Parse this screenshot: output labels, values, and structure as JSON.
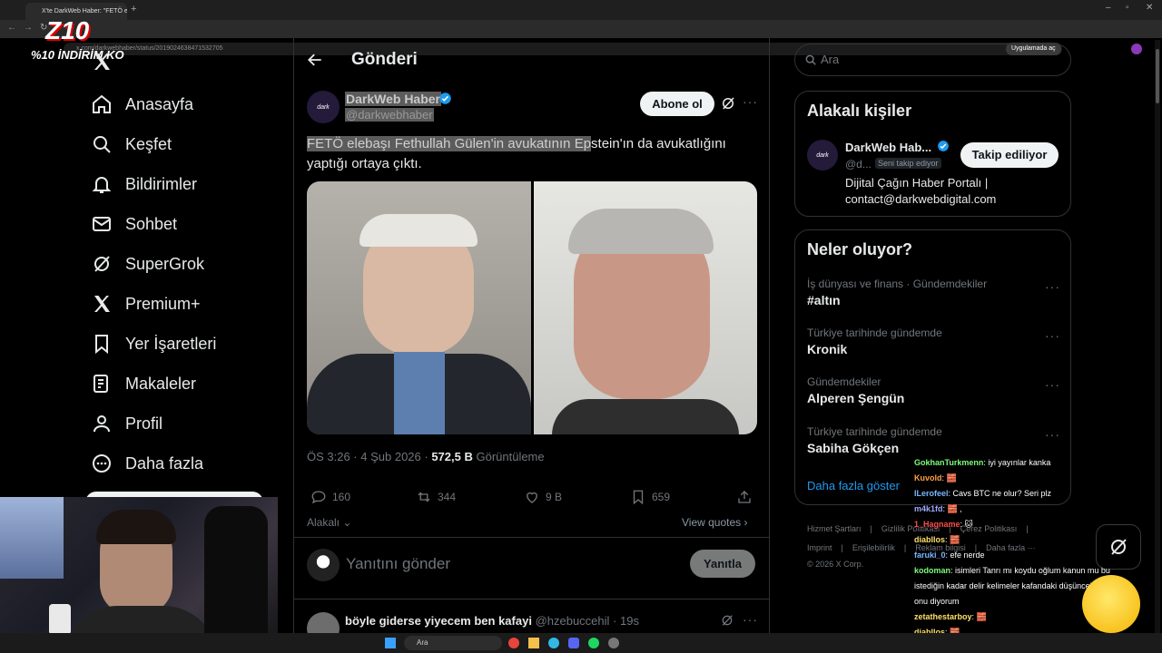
{
  "browser": {
    "tab_title": "X'te DarkWeb Haber: \"FETÖ ele...",
    "url": "x.com/darkwebhaber/status/2019024638471532705",
    "open_in_app": "Uygulamada aç"
  },
  "overlay": {
    "brand_logo": "Z10",
    "discount": "%10 İNDİRİM KO"
  },
  "nav": {
    "items": [
      {
        "label": "Anasayfa",
        "icon": "home-icon"
      },
      {
        "label": "Keşfet",
        "icon": "search-icon"
      },
      {
        "label": "Bildirimler",
        "icon": "bell-icon"
      },
      {
        "label": "Sohbet",
        "icon": "mail-icon"
      },
      {
        "label": "SuperGrok",
        "icon": "grok-icon"
      },
      {
        "label": "Premium+",
        "icon": "x-logo-icon"
      },
      {
        "label": "Yer İşaretleri",
        "icon": "bookmark-icon"
      },
      {
        "label": "Makaleler",
        "icon": "article-icon"
      },
      {
        "label": "Profil",
        "icon": "person-icon"
      },
      {
        "label": "Daha fazla",
        "icon": "more-circle-icon"
      }
    ]
  },
  "header": {
    "title": "Gönderi"
  },
  "post": {
    "author_name": "DarkWeb Haber",
    "author_handle": "@darkwebhaber",
    "avatar_text": "dark",
    "subscribe_label": "Abone ol",
    "text_highlighted": "FETÖ elebaşı Fethullah Gülen'in avukatının Ep",
    "text_rest": "stein'ın da avukatlığını yaptığı ortaya çıktı.",
    "time": "ÖS 3:26 · 4 Şub 2026 · ",
    "views_count": "572,5 B",
    "views_label": " Görüntüleme",
    "replies": "160",
    "reposts": "344",
    "likes": "9 B",
    "bookmarks": "659",
    "relevance_label": "Alakalı",
    "view_quotes": "View quotes"
  },
  "reply_box": {
    "placeholder": "Yanıtını gönder",
    "button": "Yanıtla"
  },
  "reply": {
    "text": "böyle giderse yiyecem ben kafayi",
    "handle": "@hzebuccehil",
    "age": "· 19s"
  },
  "search": {
    "placeholder": "Ara"
  },
  "related": {
    "title": "Alakalı kişiler",
    "name": "DarkWeb Hab...",
    "handle": "@d...",
    "follows_you": "Seni takip ediyor",
    "follow_button": "Takip ediliyor",
    "bio_line1": "Dijital Çağın Haber Portalı |",
    "bio_line2": "contact@darkwebdigital.com"
  },
  "trends": {
    "title": "Neler oluyor?",
    "items": [
      {
        "category": "İş dünyası ve finans · Gündemdekiler",
        "name": "#altın"
      },
      {
        "category": "Türkiye tarihinde gündemde",
        "name": "Kronik"
      },
      {
        "category": "Gündemdekiler",
        "name": "Alperen Şengün"
      },
      {
        "category": "Türkiye tarihinde gündemde",
        "name": "Sabiha Gökçen"
      }
    ],
    "show_more": "Daha fazla göster"
  },
  "footer": {
    "row1": [
      "Hizmet Şartları",
      "|",
      "Gizlilik Politikası",
      "|",
      "Çerez Politikası",
      "|"
    ],
    "row2": [
      "Imprint",
      "|",
      "Erişilebilirlik",
      "|",
      "Reklam bilgisi",
      "|",
      "Daha fazla ···"
    ],
    "copyright": "© 2026 X Corp."
  },
  "chat": [
    {
      "user": "GokhanTurkmenn",
      "color": "#7CFC7C",
      "msg": ": iyi yayınlar kanka"
    },
    {
      "user": "Kuvold",
      "color": "#FF9F43",
      "msg": ": 🧱"
    },
    {
      "user": "ILerofeel",
      "color": "#7ab8ff",
      "msg": ": Cavs BTC ne olur? Seri plz"
    },
    {
      "user": "m4k1fd",
      "color": "#9fa8ff",
      "msg": ": 🧱 ,"
    },
    {
      "user": "1_Hagname",
      "color": "#ff4d4d",
      "msg": ": 🐱"
    },
    {
      "user": "diabllos",
      "color": "#ffe066",
      "msg": ": 🧱"
    },
    {
      "user": "faruki_0",
      "color": "#7ab8ff",
      "msg": ": efe nerde"
    },
    {
      "user": "kodoman",
      "color": "#7CFC7C",
      "msg": ": isimleri Tanrı mı koydu oğlum kanun mu bu"
    },
    {
      "user": "",
      "color": "#fff",
      "msg": "istediğin kadar delir kelimeler kafandaki düşünceler ibaret"
    },
    {
      "user": "",
      "color": "#fff",
      "msg": "onu diyorum"
    },
    {
      "user": "zetathestarboy",
      "color": "#ffe066",
      "msg": ": 🧱"
    },
    {
      "user": "diabllos",
      "color": "#ffe066",
      "msg": ": 🧱"
    }
  ],
  "taskbar": {
    "search": "Ara"
  }
}
